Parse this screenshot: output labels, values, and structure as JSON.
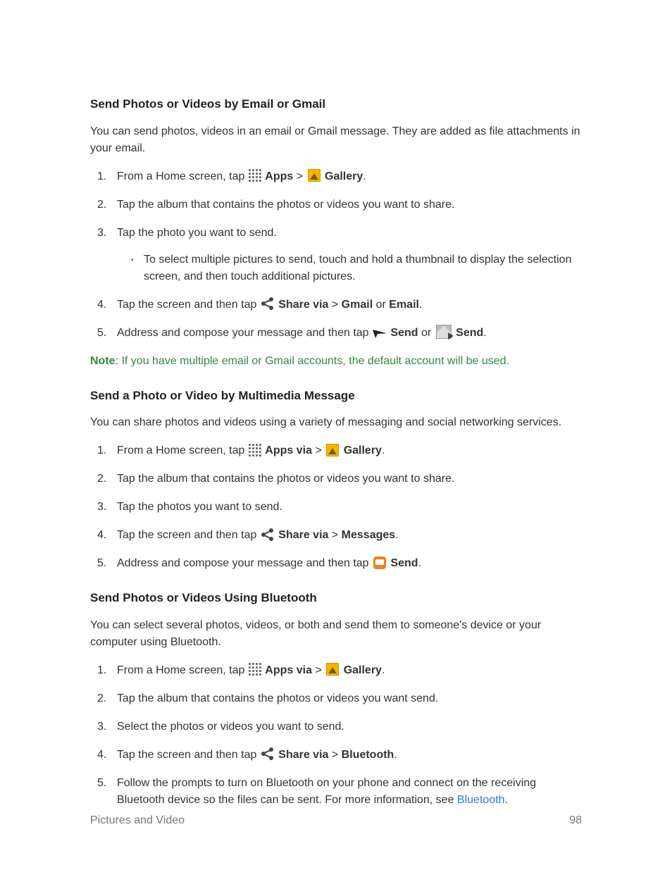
{
  "section1": {
    "heading": "Send Photos or Videos by Email or Gmail",
    "intro": "You can send photos, videos in an email or Gmail message. They are added as file attachments in your email.",
    "steps": {
      "s1_a": "From a Home screen, tap ",
      "s1_apps": "Apps",
      "s1_gt": " > ",
      "s1_gallery": "Gallery",
      "s2": "Tap the album that contains the photos or videos you want to share.",
      "s3": "Tap the photo you want to send.",
      "s3_sub": "To select multiple pictures to send, touch and hold a thumbnail to display the selection screen, and then touch additional pictures.",
      "s4_a": "Tap the screen and then tap ",
      "s4_share": "Share via",
      "s4_gt": " > ",
      "s4_gmail": "Gmail",
      "s4_or": " or ",
      "s4_email": "Email",
      "s5_a": "Address and compose your message and then tap ",
      "s5_send1": "Send",
      "s5_or": " or ",
      "s5_send2": "Send"
    },
    "note_label": "Note",
    "note_text": ": If you have multiple email or Gmail accounts, the default account will be used."
  },
  "section2": {
    "heading": "Send a Photo or Video by Multimedia Message",
    "intro": "You can share photos and videos using a variety of messaging and social networking services.",
    "steps": {
      "s1_a": "From a Home screen, tap ",
      "s1_apps": "Apps via",
      "s1_gt": " > ",
      "s1_gallery": "Gallery",
      "s2": "Tap the album that contains the photos or videos you want to share.",
      "s3": "Tap the photos you want to send.",
      "s4_a": "Tap the screen and then tap ",
      "s4_share": "Share via",
      "s4_gt": " > ",
      "s4_msgs": "Messages",
      "s5_a": "Address and compose your message and then tap ",
      "s5_send": "Send"
    }
  },
  "section3": {
    "heading": "Send Photos or Videos Using Bluetooth",
    "intro": "You can select several photos, videos, or both and send them to someone's device or your computer using Bluetooth.",
    "steps": {
      "s1_a": "From a Home screen, tap ",
      "s1_apps": "Apps via",
      "s1_gt": " > ",
      "s1_gallery": "Gallery",
      "s2": "Tap the album that contains the photos or videos you want send.",
      "s3": "Select the photos or videos you want to send.",
      "s4_a": "Tap the screen and then tap ",
      "s4_share": "Share via",
      "s4_gt": " > ",
      "s4_bt": "Bluetooth",
      "s5_a": "Follow the prompts to turn on Bluetooth on your phone and connect on the receiving Bluetooth device so the files can be sent. For more information, see ",
      "s5_link": "Bluetooth"
    }
  },
  "footer": {
    "left": "Pictures and Video",
    "right": "98"
  },
  "period": "."
}
